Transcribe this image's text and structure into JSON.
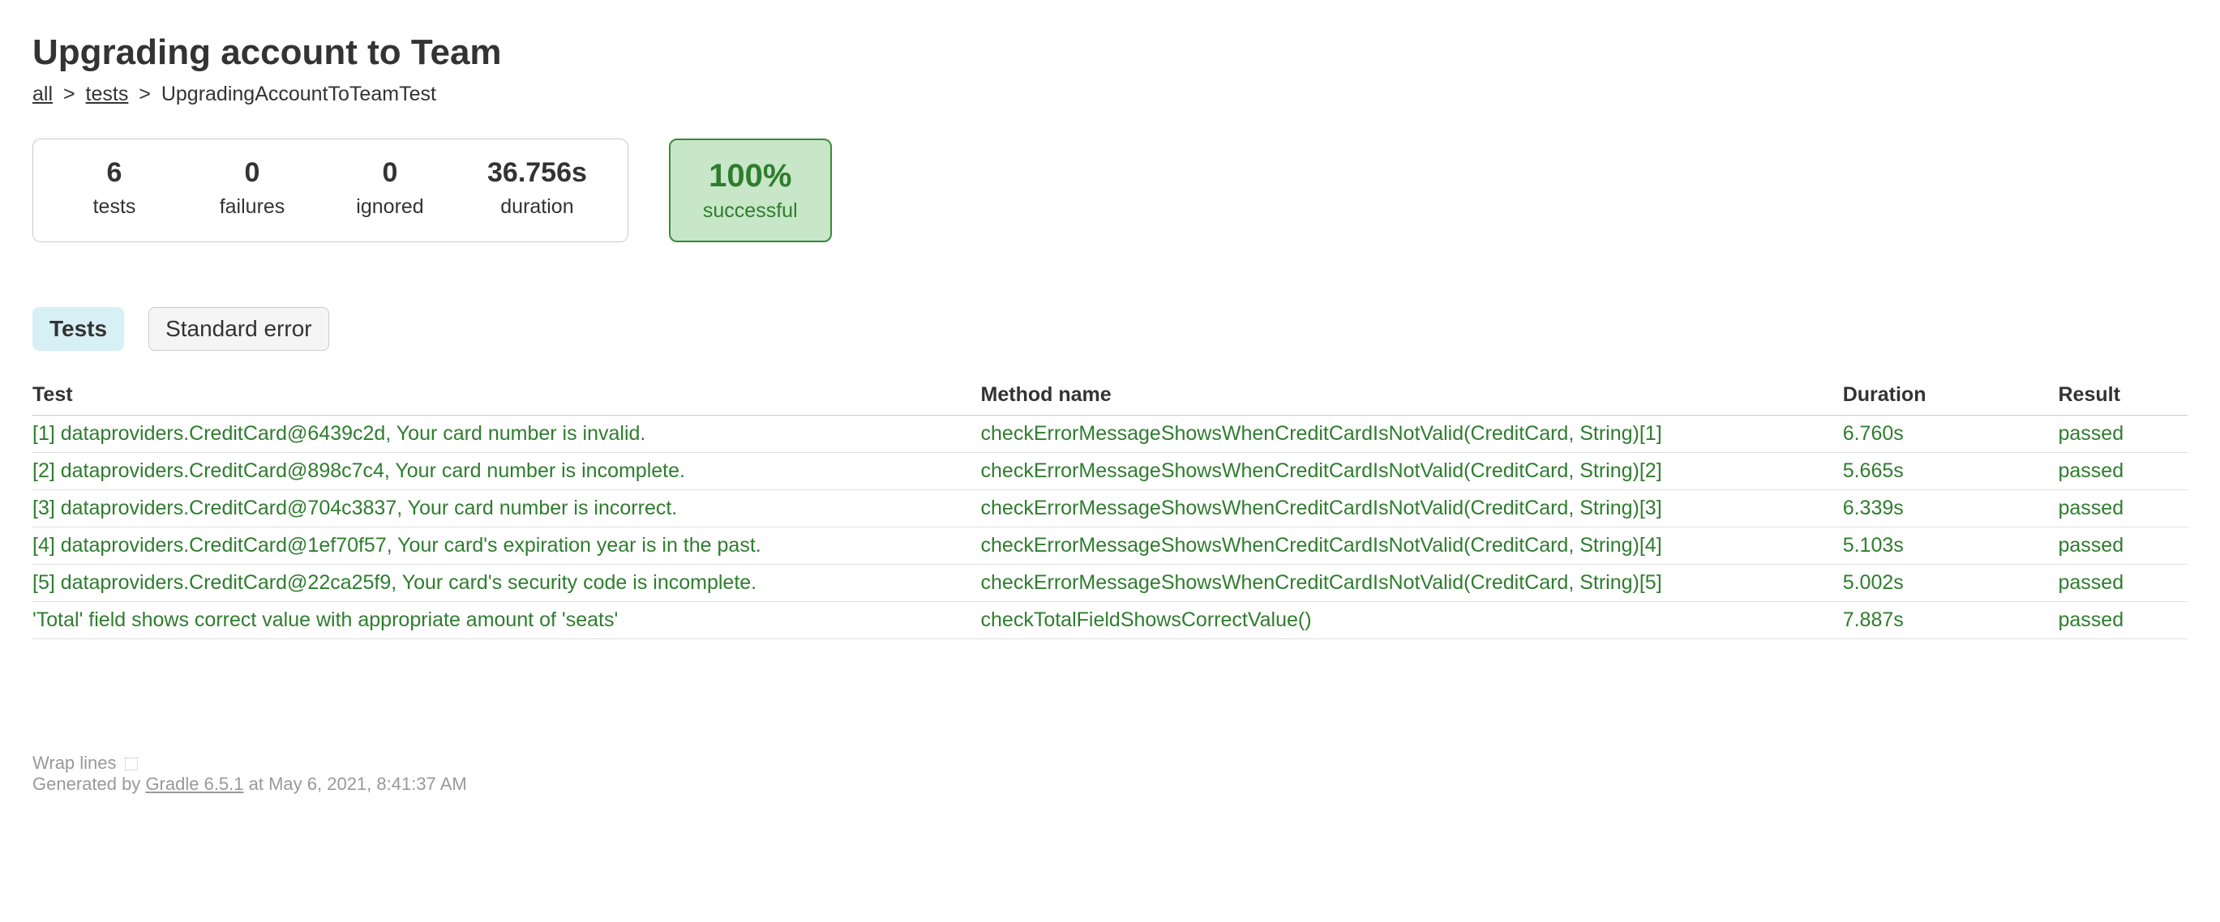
{
  "title": "Upgrading account to Team",
  "breadcrumb": {
    "all": "all",
    "tests": "tests",
    "current": "UpgradingAccountToTeamTest"
  },
  "stats": {
    "tests": {
      "value": "6",
      "label": "tests"
    },
    "failures": {
      "value": "0",
      "label": "failures"
    },
    "ignored": {
      "value": "0",
      "label": "ignored"
    },
    "duration": {
      "value": "36.756s",
      "label": "duration"
    }
  },
  "success": {
    "percent": "100%",
    "label": "successful"
  },
  "tabs": {
    "tests": "Tests",
    "stderr": "Standard error"
  },
  "table": {
    "headers": {
      "test": "Test",
      "method": "Method name",
      "duration": "Duration",
      "result": "Result"
    },
    "rows": [
      {
        "test": "[1] dataproviders.CreditCard@6439c2d, Your card number is invalid.",
        "method": "checkErrorMessageShowsWhenCreditCardIsNotValid(CreditCard, String)[1]",
        "duration": "6.760s",
        "result": "passed"
      },
      {
        "test": "[2] dataproviders.CreditCard@898c7c4, Your card number is incomplete.",
        "method": "checkErrorMessageShowsWhenCreditCardIsNotValid(CreditCard, String)[2]",
        "duration": "5.665s",
        "result": "passed"
      },
      {
        "test": "[3] dataproviders.CreditCard@704c3837, Your card number is incorrect.",
        "method": "checkErrorMessageShowsWhenCreditCardIsNotValid(CreditCard, String)[3]",
        "duration": "6.339s",
        "result": "passed"
      },
      {
        "test": "[4] dataproviders.CreditCard@1ef70f57, Your card's expiration year is in the past.",
        "method": "checkErrorMessageShowsWhenCreditCardIsNotValid(CreditCard, String)[4]",
        "duration": "5.103s",
        "result": "passed"
      },
      {
        "test": "[5] dataproviders.CreditCard@22ca25f9, Your card's security code is incomplete.",
        "method": "checkErrorMessageShowsWhenCreditCardIsNotValid(CreditCard, String)[5]",
        "duration": "5.002s",
        "result": "passed"
      },
      {
        "test": "'Total' field shows correct value with appropriate amount of 'seats'",
        "method": "checkTotalFieldShowsCorrectValue()",
        "duration": "7.887s",
        "result": "passed"
      }
    ]
  },
  "footer": {
    "wrap_label": "Wrap lines",
    "generated_prefix": "Generated by ",
    "gradle_link": "Gradle 6.5.1",
    "generated_suffix": " at May 6, 2021, 8:41:37 AM"
  }
}
